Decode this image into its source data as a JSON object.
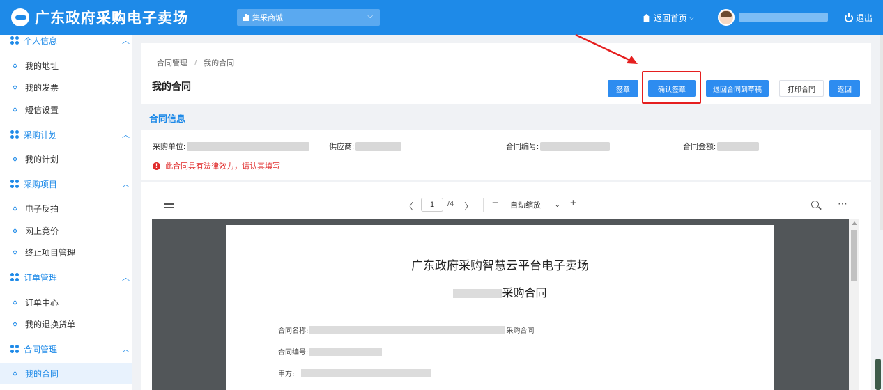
{
  "header": {
    "site_title": "广东政府采购电子卖场",
    "mall_select": "集采商城",
    "home_link": "返回首页",
    "logout": "退出"
  },
  "sidebar": {
    "groups": [
      {
        "label": "个人信息",
        "items": [
          "我的地址",
          "我的发票",
          "短信设置"
        ]
      },
      {
        "label": "采购计划",
        "items": [
          "我的计划"
        ]
      },
      {
        "label": "采购项目",
        "items": [
          "电子反拍",
          "网上竞价",
          "终止项目管理"
        ]
      },
      {
        "label": "订单管理",
        "items": [
          "订单中心",
          "我的退换货单"
        ]
      },
      {
        "label": "合同管理",
        "items": [
          "我的合同"
        ]
      }
    ],
    "active_item": "我的合同"
  },
  "page": {
    "breadcrumb": [
      "合同管理",
      "我的合同"
    ],
    "breadcrumb_sep": "/",
    "title": "我的合同",
    "buttons": {
      "sign": "签章",
      "confirm_sign": "确认签章",
      "return_draft": "退回合同到草稿",
      "print": "打印合同",
      "back": "返回"
    }
  },
  "contract_info": {
    "section_title": "合同信息",
    "buyer_label": "采购单位:",
    "supplier_label": "供应商:",
    "contract_no_label": "合同编号:",
    "amount_label": "合同金额:",
    "warning": "此合同具有法律效力，请认真填写"
  },
  "pdf_viewer": {
    "current_page": "1",
    "total_pages": "/4",
    "zoom": "自动缩放",
    "doc_title": "广东政府采购智慧云平台电子卖场",
    "doc_subtitle": "采购合同",
    "fields": {
      "name_label": "合同名称:",
      "name_suffix": "采购合同",
      "no_label": "合同编号:",
      "party_a_label": "甲方:"
    }
  },
  "colors": {
    "header_bg": "#1e8ae8",
    "primary": "#2d8cf0",
    "highlight": "#e51f1f",
    "warning": "#e02b2b"
  }
}
